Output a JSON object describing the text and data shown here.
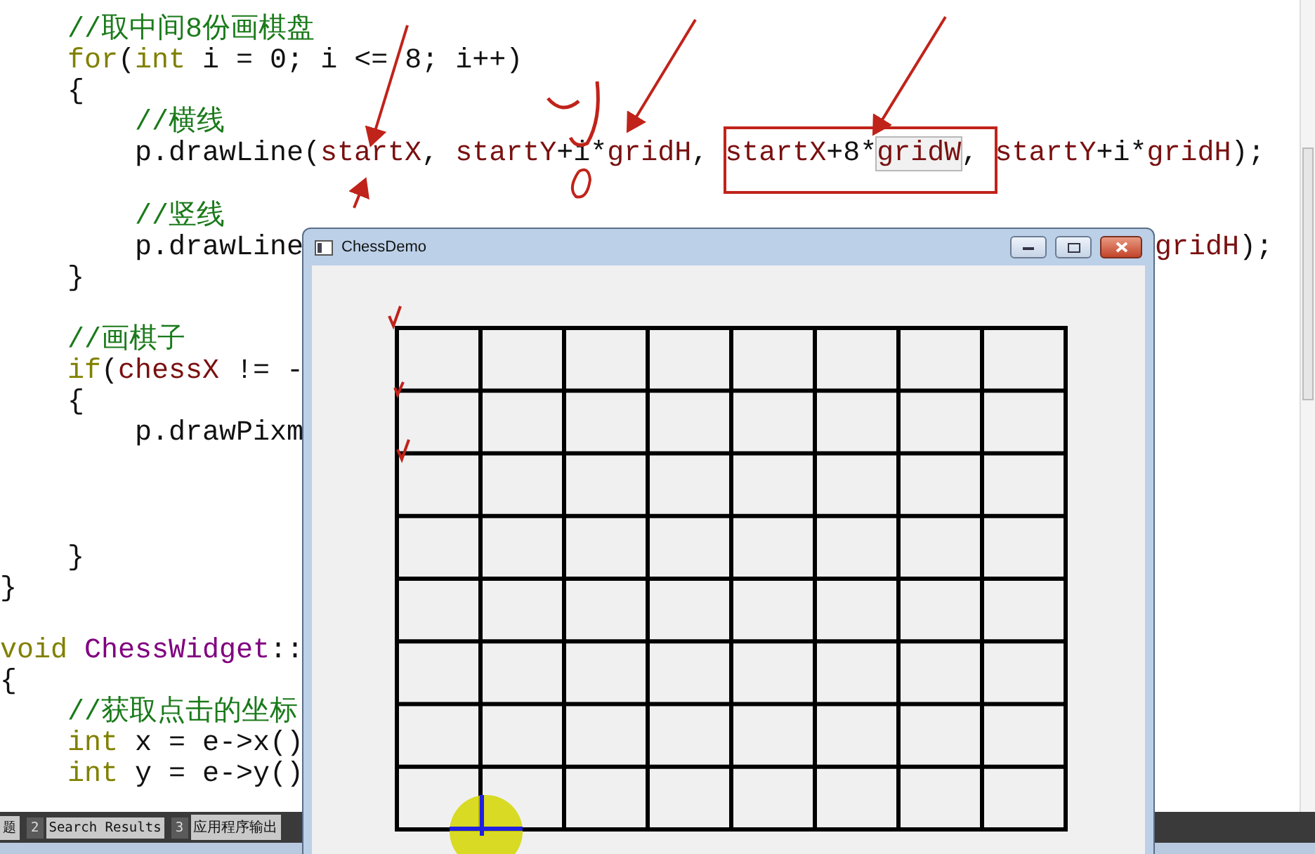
{
  "editor": {
    "lines": [
      {
        "kind": "code",
        "segments": [
          {
            "kind": "comment",
            "text": "    //取中间8份画棋盘"
          }
        ]
      },
      {
        "kind": "code",
        "segments": [
          {
            "kind": "keyword",
            "text": "    for"
          },
          {
            "kind": "plain",
            "text": "("
          },
          {
            "kind": "keyword",
            "text": "int"
          },
          {
            "kind": "plain",
            "text": " i = 0; i <= 8; i++)"
          }
        ]
      },
      {
        "kind": "code",
        "segments": [
          {
            "kind": "plain",
            "text": "    {"
          }
        ]
      },
      {
        "kind": "code",
        "segments": [
          {
            "kind": "comment",
            "text": "        //横线"
          }
        ]
      },
      {
        "kind": "code",
        "segments": [
          {
            "kind": "plain",
            "text": "        p.drawLine("
          },
          {
            "kind": "ident",
            "text": "startX"
          },
          {
            "kind": "plain",
            "text": ", "
          },
          {
            "kind": "ident",
            "text": "startY"
          },
          {
            "kind": "plain",
            "text": "+i*"
          },
          {
            "kind": "ident",
            "text": "gridH"
          },
          {
            "kind": "plain",
            "text": ", "
          },
          {
            "kind": "ident",
            "text": "startX"
          },
          {
            "kind": "plain",
            "text": "+8*"
          },
          {
            "kind": "match",
            "text": "gridW"
          },
          {
            "kind": "plain",
            "text": ", "
          },
          {
            "kind": "ident",
            "text": "startY"
          },
          {
            "kind": "plain",
            "text": "+i*"
          },
          {
            "kind": "ident",
            "text": "gridH"
          },
          {
            "kind": "plain",
            "text": ");"
          }
        ]
      },
      {
        "kind": "blank"
      },
      {
        "kind": "code",
        "segments": [
          {
            "kind": "comment",
            "text": "        //竖线"
          }
        ]
      },
      {
        "kind": "code",
        "segments": [
          {
            "kind": "plain",
            "text": "        p.drawLine"
          }
        ],
        "right": [
          {
            "kind": "ident",
            "text": "gridH"
          },
          {
            "kind": "plain",
            "text": ");"
          }
        ]
      },
      {
        "kind": "code",
        "segments": [
          {
            "kind": "plain",
            "text": "    }"
          }
        ]
      },
      {
        "kind": "blank"
      },
      {
        "kind": "code",
        "segments": [
          {
            "kind": "comment",
            "text": "    //画棋子"
          }
        ]
      },
      {
        "kind": "code",
        "segments": [
          {
            "kind": "keyword",
            "text": "    if"
          },
          {
            "kind": "plain",
            "text": "("
          },
          {
            "kind": "ident",
            "text": "chessX"
          },
          {
            "kind": "plain",
            "text": " != -"
          }
        ]
      },
      {
        "kind": "code",
        "segments": [
          {
            "kind": "plain",
            "text": "    {"
          }
        ]
      },
      {
        "kind": "code",
        "segments": [
          {
            "kind": "plain",
            "text": "        p.drawPixm"
          }
        ]
      },
      {
        "kind": "blank"
      },
      {
        "kind": "blank"
      },
      {
        "kind": "blank"
      },
      {
        "kind": "code",
        "segments": [
          {
            "kind": "plain",
            "text": "    }"
          }
        ]
      },
      {
        "kind": "code",
        "segments": [
          {
            "kind": "plain",
            "text": "}"
          }
        ]
      },
      {
        "kind": "blank"
      },
      {
        "kind": "code",
        "segments": [
          {
            "kind": "keyword",
            "text": "void "
          },
          {
            "kind": "type",
            "text": "ChessWidget"
          },
          {
            "kind": "plain",
            "text": "::"
          }
        ]
      },
      {
        "kind": "code",
        "segments": [
          {
            "kind": "plain",
            "text": "{"
          }
        ]
      },
      {
        "kind": "code",
        "segments": [
          {
            "kind": "comment",
            "text": "    //获取点击的坐标"
          }
        ]
      },
      {
        "kind": "code",
        "segments": [
          {
            "kind": "keyword",
            "text": "    int"
          },
          {
            "kind": "plain",
            "text": " x = e->x()"
          }
        ]
      },
      {
        "kind": "code",
        "segments": [
          {
            "kind": "keyword",
            "text": "    int"
          },
          {
            "kind": "plain",
            "text": " y = e->y()"
          }
        ]
      }
    ]
  },
  "output_tabs": [
    {
      "label": "题"
    },
    {
      "number": "2",
      "label": "Search Results"
    },
    {
      "number": "3",
      "label": "应用程序输出"
    }
  ],
  "app_window": {
    "title": "ChessDemo"
  }
}
